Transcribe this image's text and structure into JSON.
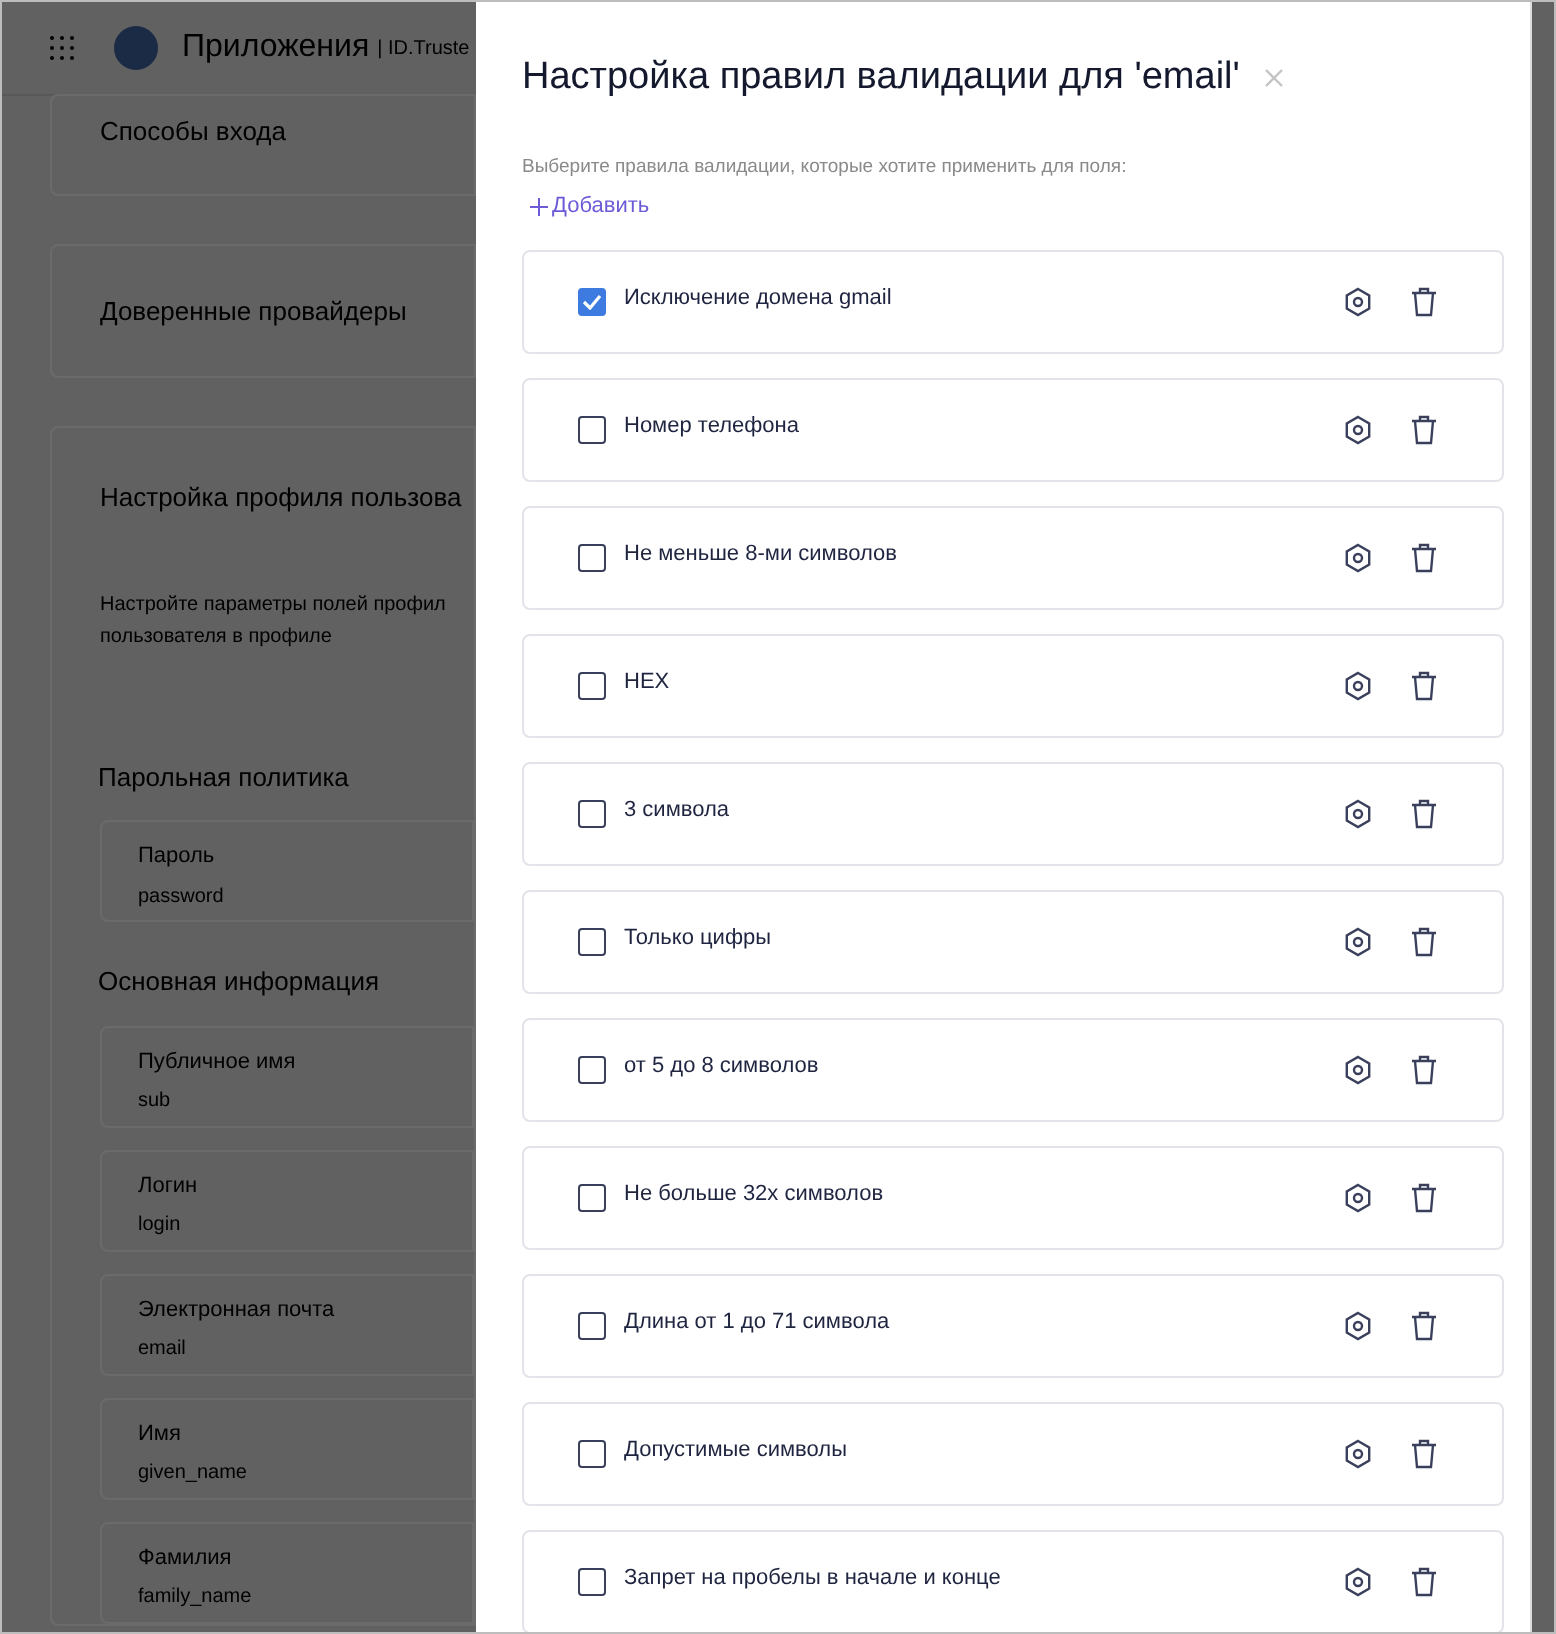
{
  "background": {
    "header": {
      "title": "Приложения",
      "subtitle": "| ID.Truste"
    },
    "cards": [
      {
        "title": "Способы входа"
      },
      {
        "title": "Доверенные провайдеры"
      }
    ],
    "profile": {
      "title": "Настройка профиля пользова",
      "description": "Настройте параметры полей профил\nпользователя в профиле",
      "sections": [
        {
          "title": "Парольная политика",
          "fields": [
            {
              "label": "Пароль",
              "value": "password"
            }
          ]
        },
        {
          "title": "Основная информация",
          "fields": [
            {
              "label": "Публичное имя",
              "value": "sub"
            },
            {
              "label": "Логин",
              "value": "login"
            },
            {
              "label": "Электронная почта",
              "value": "email"
            },
            {
              "label": "Имя",
              "value": "given_name"
            },
            {
              "label": "Фамилия",
              "value": "family_name"
            }
          ]
        }
      ]
    }
  },
  "drawer": {
    "title": "Настройка правил валидации для 'email'",
    "hint": "Выберите правила валидации, которые хотите применить для поля:",
    "add_label": "Добавить",
    "rules": [
      {
        "label": "Исключение домена gmail",
        "checked": true
      },
      {
        "label": "Номер телефона",
        "checked": false
      },
      {
        "label": "Не меньше 8-ми символов",
        "checked": false
      },
      {
        "label": "HEX",
        "checked": false
      },
      {
        "label": "3 символа",
        "checked": false
      },
      {
        "label": "Только цифры",
        "checked": false
      },
      {
        "label": "от 5 до 8 символов",
        "checked": false
      },
      {
        "label": "Не больше 32х символов",
        "checked": false
      },
      {
        "label": "Длина от 1 до 71 символа",
        "checked": false
      },
      {
        "label": "Допустимые символы",
        "checked": false
      },
      {
        "label": "Запрет на пробелы в начале и конце",
        "checked": false
      }
    ]
  }
}
